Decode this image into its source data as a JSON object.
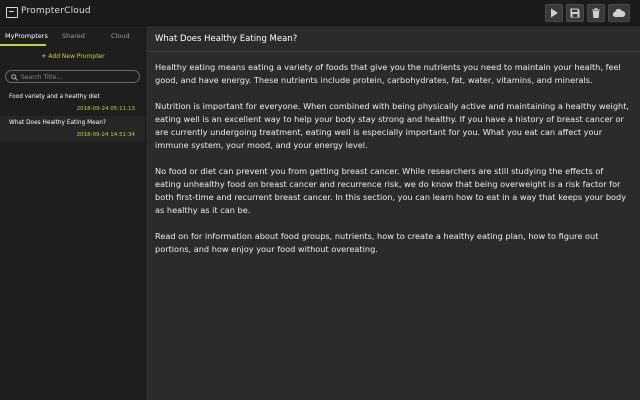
{
  "app": {
    "title": "PrompterCloud"
  },
  "toolbar": {
    "buttons": [
      {
        "name": "play-button",
        "icon": "play-icon"
      },
      {
        "name": "save-button",
        "icon": "floppy-disk-icon"
      },
      {
        "name": "delete-button",
        "icon": "trash-icon"
      },
      {
        "name": "cloud-button",
        "icon": "cloud-icon"
      }
    ]
  },
  "sidebar": {
    "tabs": [
      {
        "label": "MyPrompters",
        "active": true
      },
      {
        "label": "Shared",
        "active": false
      },
      {
        "label": "Cloud",
        "active": false
      }
    ],
    "add_new_label": "Add New Prompter",
    "search": {
      "placeholder": "Search Title...",
      "value": ""
    },
    "items": [
      {
        "title": "Food variety and a healthy diet",
        "date": "2018-09-24 05:11:13",
        "selected": false
      },
      {
        "title": "What Does Healthy Eating Mean?",
        "date": "2018-09-24 14:51:34",
        "selected": true
      }
    ]
  },
  "document": {
    "title": "What Does Healthy Eating Mean?",
    "paragraphs": [
      "Healthy eating means eating a variety of foods that give you the nutrients you need to maintain your health, feel good, and have energy. These nutrients include protein, carbohydrates, fat, water, vitamins, and minerals.",
      "Nutrition is important for everyone. When combined with being physically active and maintaining a healthy weight, eating well is an excellent way to help your body stay strong and healthy. If you have a history of breast cancer or are currently undergoing treatment, eating well is especially important for you. What you eat can affect your immune system, your mood, and your energy level.",
      "No food or diet can prevent you from getting breast cancer. While researchers are still studying the effects of eating unhealthy food on breast cancer and recurrence risk, we do know that being overweight is a risk factor for both first-time and recurrent breast cancer. In this section, you can learn how to eat in a way that keeps your body as healthy as it can be.",
      "Read on for information about food groups, nutrients, how to create a healthy eating plan, how to figure out portions, and how enjoy your food without overeating."
    ]
  },
  "colors": {
    "accent": "#c4d132",
    "topbar": "#1b1b1b",
    "sidebar": "#1e1e1e",
    "main": "#2b2b2b"
  }
}
